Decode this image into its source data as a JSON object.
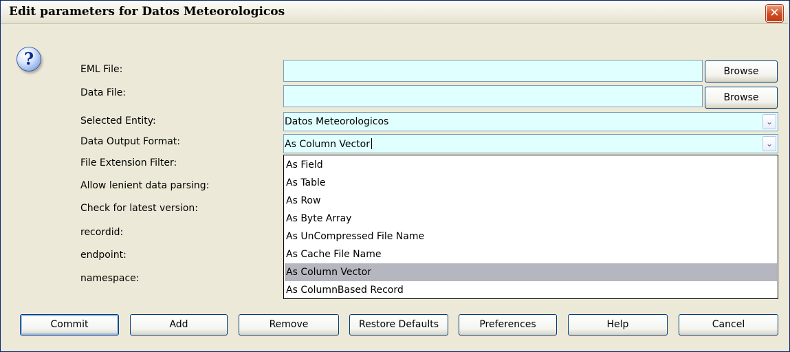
{
  "window": {
    "title": "Edit parameters for Datos Meteorologicos",
    "close_glyph": "✕"
  },
  "icons": {
    "help": "help-question-icon",
    "close": "close-icon",
    "dropdown": "chevron-down-icon"
  },
  "help_glyph": "?",
  "fields": {
    "eml_file": {
      "label": "EML File:",
      "value": ""
    },
    "data_file": {
      "label": "Data File:",
      "value": ""
    },
    "selected_entity": {
      "label": "Selected Entity:",
      "value": "Datos Meteorologicos"
    },
    "data_output_format": {
      "label": "Data Output Format:",
      "value": "As Column Vector"
    },
    "file_extension_filter": {
      "label": "File Extension Filter:"
    },
    "allow_lenient": {
      "label": "Allow lenient data parsing:"
    },
    "check_latest": {
      "label": "Check for latest version:"
    },
    "recordid": {
      "label": "recordid:"
    },
    "endpoint": {
      "label": "endpoint:"
    },
    "namespace": {
      "label": "namespace:"
    }
  },
  "browse_label": "Browse",
  "arrow_glyph": "⌄",
  "dropdown_options": [
    "As Field",
    "As Table",
    "As Row",
    "As Byte Array",
    "As UnCompressed File Name",
    "As Cache File Name",
    "As Column Vector",
    "As ColumnBased Record"
  ],
  "selected_option": "As Column Vector",
  "buttons": {
    "commit": "Commit",
    "add": "Add",
    "remove": "Remove",
    "restore": "Restore Defaults",
    "preferences": "Preferences",
    "help": "Help",
    "cancel": "Cancel"
  },
  "colors": {
    "field_bg": "#e0ffff",
    "selection": "#b6b6c0",
    "dialog_bg": "#ece9d8"
  }
}
